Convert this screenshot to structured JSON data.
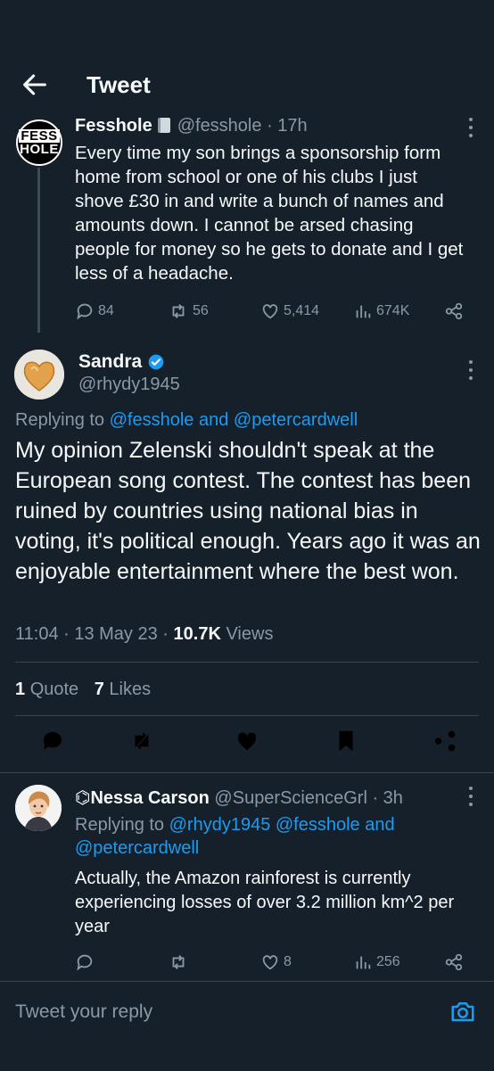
{
  "header": {
    "title": "Tweet"
  },
  "parent_tweet": {
    "avatar_lines": [
      "FESS",
      "HOLE"
    ],
    "name": "Fesshole",
    "handle": "@fesshole",
    "time": "· 17h",
    "text": "Every time my son brings a sponsorship form home from school or one of his clubs I just shove £30 in and write a bunch of names and amounts down. I cannot be arsed chasing people for money so he gets to donate and I get less of a headache.",
    "replies": "84",
    "retweets": "56",
    "likes": "5,414",
    "views": "674K"
  },
  "main_tweet": {
    "name": "Sandra",
    "handle": "@rhydy1945",
    "replying_prefix": "Replying to",
    "replying_to": "@fesshole and @petercardwell",
    "text": "My opinion Zelenski shouldn't speak at the European song contest. The contest has been ruined by countries using national bias in voting, it's political enough. Years ago it was an enjoyable entertainment where the best won.",
    "timestamp": "11:04 · 13 May 23 ·",
    "views_count": "10.7K",
    "views_label": "Views",
    "quotes_count": "1",
    "quotes_label": "Quote",
    "likes_count": "7",
    "likes_label": "Likes"
  },
  "reply_tweet": {
    "name": "⌬Nessa Carson",
    "handle": "@SuperScienceGrl",
    "time": "· 3h",
    "replying_prefix": "Replying to",
    "replying_line1": "@rhydy1945 @fesshole and",
    "replying_line2": "@petercardwell",
    "text": "Actually, the Amazon rainforest is currently experiencing losses of over 3.2 million km^2 per year",
    "retweets": "",
    "likes": "8",
    "views": "256"
  },
  "compose": {
    "placeholder": "Tweet your reply"
  },
  "colors": {
    "background": "#15202b",
    "accent": "#1d9bf0",
    "muted": "#8b98a5",
    "text": "#f7f9f9"
  }
}
